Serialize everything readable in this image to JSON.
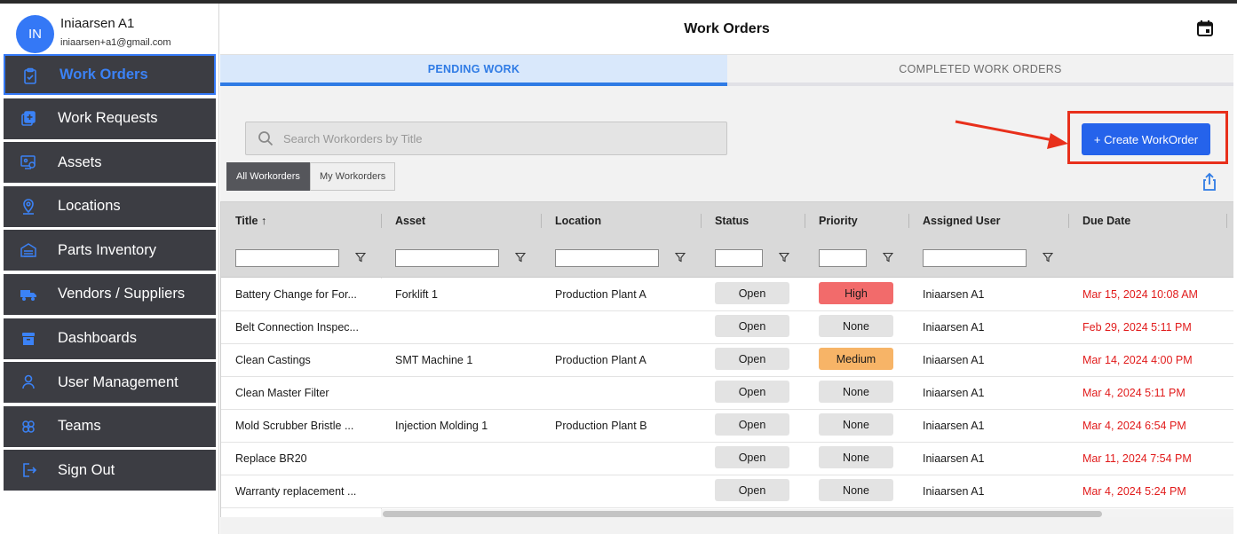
{
  "user": {
    "initials": "IN",
    "name": "Iniaarsen A1",
    "email": "iniaarsen+a1@gmail.com"
  },
  "sidebar": {
    "items": [
      {
        "label": "Work Orders",
        "icon": "clipboard-check-icon",
        "active": true
      },
      {
        "label": "Work Requests",
        "icon": "add-request-icon",
        "active": false
      },
      {
        "label": "Assets",
        "icon": "assets-icon",
        "active": false
      },
      {
        "label": "Locations",
        "icon": "location-pin-icon",
        "active": false
      },
      {
        "label": "Parts Inventory",
        "icon": "warehouse-icon",
        "active": false
      },
      {
        "label": "Vendors / Suppliers",
        "icon": "truck-icon",
        "active": false
      },
      {
        "label": "Dashboards",
        "icon": "archive-box-icon",
        "active": false
      },
      {
        "label": "User Management",
        "icon": "user-icon",
        "active": false
      },
      {
        "label": "Teams",
        "icon": "team-icon",
        "active": false
      },
      {
        "label": "Sign Out",
        "icon": "sign-out-icon",
        "active": false
      }
    ]
  },
  "header": {
    "title": "Work Orders",
    "calendar_icon": "calendar-icon"
  },
  "tabs": [
    {
      "label": "PENDING WORK",
      "active": true
    },
    {
      "label": "COMPLETED WORK ORDERS",
      "active": false
    }
  ],
  "search": {
    "placeholder": "Search Workorders by Title"
  },
  "create_button": {
    "label": "+  Create WorkOrder"
  },
  "filters": [
    {
      "label": "All Workorders",
      "active": true
    },
    {
      "label": "My Workorders",
      "active": false
    }
  ],
  "table": {
    "columns": [
      "Title",
      "Asset",
      "Location",
      "Status",
      "Priority",
      "Assigned User",
      "Due Date"
    ],
    "sort": {
      "column": "Title",
      "direction": "ascending"
    },
    "rows": [
      {
        "title": "Battery Change for For...",
        "asset": "Forklift 1",
        "location": "Production Plant A",
        "status": "Open",
        "priority": "High",
        "assigned": "Iniaarsen A1",
        "due": "Mar 15, 2024 10:08 AM"
      },
      {
        "title": "Belt Connection Inspec...",
        "asset": "",
        "location": "",
        "status": "Open",
        "priority": "None",
        "assigned": "Iniaarsen A1",
        "due": "Feb 29, 2024 5:11 PM"
      },
      {
        "title": "Clean Castings",
        "asset": "SMT Machine 1",
        "location": "Production Plant A",
        "status": "Open",
        "priority": "Medium",
        "assigned": "Iniaarsen A1",
        "due": "Mar 14, 2024 4:00 PM"
      },
      {
        "title": "Clean Master Filter",
        "asset": "",
        "location": "",
        "status": "Open",
        "priority": "None",
        "assigned": "Iniaarsen A1",
        "due": "Mar 4, 2024 5:11 PM"
      },
      {
        "title": "Mold Scrubber Bristle ...",
        "asset": "Injection Molding 1",
        "location": "Production Plant B",
        "status": "Open",
        "priority": "None",
        "assigned": "Iniaarsen A1",
        "due": "Mar 4, 2024 6:54 PM"
      },
      {
        "title": "Replace BR20",
        "asset": "",
        "location": "",
        "status": "Open",
        "priority": "None",
        "assigned": "Iniaarsen A1",
        "due": "Mar 11, 2024 7:54 PM"
      },
      {
        "title": "Warranty replacement ...",
        "asset": "",
        "location": "",
        "status": "Open",
        "priority": "None",
        "assigned": "Iniaarsen A1",
        "due": "Mar 4, 2024 5:24 PM"
      }
    ]
  },
  "colors": {
    "accent": "#2563eb",
    "sidebar_bg": "#3c3d43",
    "priority_high": "#f26b6b",
    "priority_medium": "#f7b467",
    "due_date": "#e11b1b",
    "annotation_red": "#e8301c"
  }
}
